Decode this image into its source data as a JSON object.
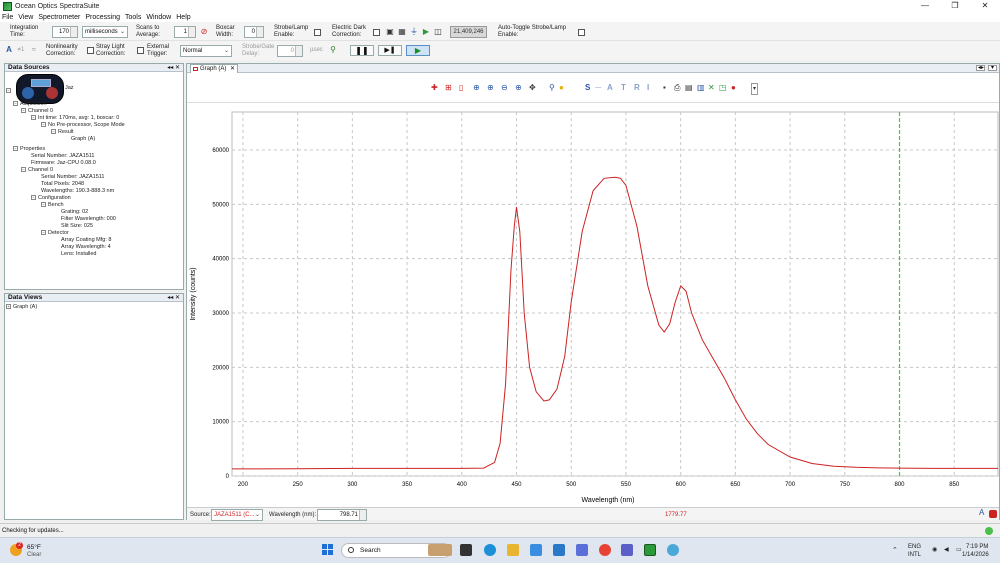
{
  "window": {
    "title": "Ocean Optics SpectraSuite",
    "controls": [
      "—",
      "❐",
      "✕"
    ]
  },
  "menu": [
    "File",
    "View",
    "Spectrometer",
    "Processing",
    "Tools",
    "Window",
    "Help"
  ],
  "toolbar": {
    "integration_label": "Integration Time:",
    "integration_value": "170",
    "integration_unit": "milliseconds",
    "scans_label": "Scans to Average:",
    "scans_value": "1",
    "boxcar_label": "Boxcar Width:",
    "boxcar_value": "0",
    "strobe_label": "Strobe/Lamp Enable:",
    "edc_label": "Electric Dark Correction:",
    "counter_value": "21,409,246",
    "auto_toggle_label": "Auto-Toggle Strobe/Lamp Enable:",
    "nonlinearity_label": "Nonlinearity Correction:",
    "stray_light_label": "Stray Light Correction:",
    "external_trigger_label": "External Trigger:",
    "trigger_mode": "Normal",
    "strobe_delay_label": "Strobe/Gate Delay:",
    "strobe_delay_value": "0",
    "strobe_delay_unit": "µsec"
  },
  "data_sources": {
    "title": "Data Sources",
    "device": "Jaz",
    "nodes": [
      "Acquisition",
      "Channel 0",
      "Int time: 170ms, avg: 1, boxcar: 0",
      "No Pre-processor, Scope Mode",
      "Result",
      "Graph (A)",
      "Properties",
      "Serial Number: JAZA1511",
      "Firmware: Jaz-CPU 0.08.0",
      "Channel 0",
      "Serial Number: JAZA1511",
      "Total Pixels: 2048",
      "Wavelengths: 190.3-888.3 nm",
      "Configuration",
      "Bench",
      "Grating: 02",
      "Filter Wavelength: 000",
      "Slit Size: 025",
      "Detector",
      "Array Coating Mfg: 8",
      "Array Wavelength: 4",
      "Lens: Installed"
    ]
  },
  "data_views": {
    "title": "Data Views",
    "nodes": [
      "Graph (A)"
    ]
  },
  "graph_tab": {
    "label": "Graph (A)"
  },
  "chart_data": {
    "type": "line",
    "title": "",
    "xlabel": "Wavelength (nm)",
    "ylabel": "Intensity (counts)",
    "xlim": [
      190,
      890
    ],
    "ylim": [
      0,
      67000
    ],
    "x_ticks": [
      200,
      250,
      300,
      350,
      400,
      450,
      500,
      550,
      600,
      650,
      700,
      750,
      800,
      850
    ],
    "y_ticks": [
      0,
      10000,
      20000,
      30000,
      40000,
      50000,
      60000
    ],
    "grid": true,
    "cursor_x": 800,
    "series": [
      {
        "color": "#cc2222",
        "x": [
          190,
          250,
          300,
          350,
          400,
          420,
          430,
          435,
          440,
          445,
          448,
          450,
          453,
          457,
          462,
          468,
          475,
          480,
          487,
          494,
          500,
          510,
          520,
          530,
          540,
          545,
          550,
          560,
          570,
          580,
          585,
          590,
          595,
          600,
          605,
          610,
          620,
          630,
          640,
          650,
          660,
          670,
          680,
          700,
          720,
          740,
          760,
          780,
          800,
          830,
          860,
          890
        ],
        "y": [
          1300,
          1350,
          1400,
          1400,
          1400,
          1450,
          2500,
          6000,
          17000,
          38000,
          46000,
          49500,
          45000,
          30000,
          20000,
          15500,
          13800,
          14000,
          16000,
          22000,
          32000,
          45000,
          52500,
          54800,
          55000,
          54800,
          53500,
          46000,
          35000,
          27800,
          26500,
          28000,
          32000,
          35000,
          34000,
          30000,
          25000,
          21500,
          18000,
          14000,
          10500,
          7800,
          5800,
          3500,
          2300,
          1800,
          1600,
          1500,
          1450,
          1400,
          1400,
          1400
        ]
      }
    ]
  },
  "source_bar": {
    "source_label": "Source:",
    "source_value": "JAZA1511 (C...",
    "wavelength_label": "Wavelength (nm):",
    "wavelength_value": "798.71",
    "intensity_value": "1779.77"
  },
  "status": {
    "text": "Checking for updates..."
  },
  "taskbar": {
    "weather_temp": "65°F",
    "weather_cond": "Clear",
    "weather_badge": "2",
    "search_placeholder": "Search",
    "lang1": "ENG",
    "lang2": "INTL",
    "time": "7:19 PM",
    "date": "1/14/2026"
  }
}
